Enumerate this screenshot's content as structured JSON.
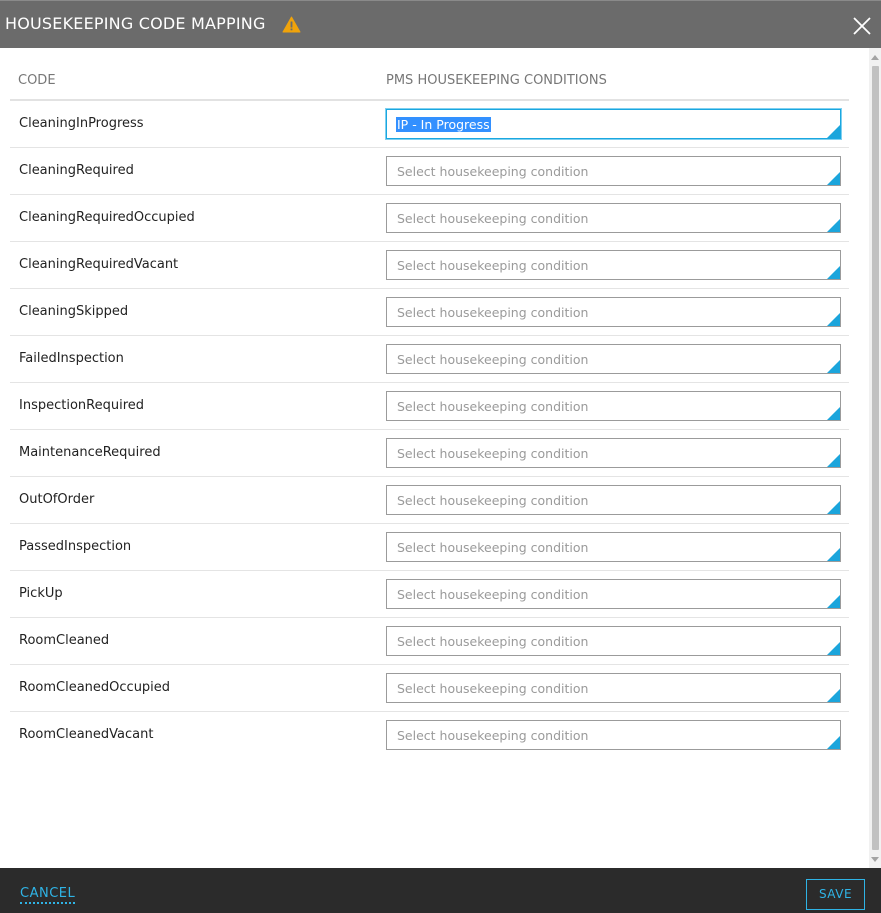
{
  "dialog": {
    "title": "HOUSEKEEPING CODE MAPPING",
    "warning_icon": "warning-triangle-icon",
    "close_icon": "close-icon"
  },
  "table": {
    "headers": {
      "code": "CODE",
      "pms": "PMS HOUSEKEEPING CONDITIONS"
    },
    "placeholder": "Select housekeeping condition",
    "rows": [
      {
        "code": "CleaningInProgress",
        "value": "IP - In Progress"
      },
      {
        "code": "CleaningRequired",
        "value": ""
      },
      {
        "code": "CleaningRequiredOccupied",
        "value": ""
      },
      {
        "code": "CleaningRequiredVacant",
        "value": ""
      },
      {
        "code": "CleaningSkipped",
        "value": ""
      },
      {
        "code": "FailedInspection",
        "value": ""
      },
      {
        "code": "InspectionRequired",
        "value": ""
      },
      {
        "code": "MaintenanceRequired",
        "value": ""
      },
      {
        "code": "OutOfOrder",
        "value": ""
      },
      {
        "code": "PassedInspection",
        "value": ""
      },
      {
        "code": "PickUp",
        "value": ""
      },
      {
        "code": "RoomCleaned",
        "value": ""
      },
      {
        "code": "RoomCleanedOccupied",
        "value": ""
      },
      {
        "code": "RoomCleanedVacant",
        "value": ""
      }
    ]
  },
  "footer": {
    "cancel_label": "CANCEL",
    "save_label": "SAVE"
  },
  "colors": {
    "titlebar": "#6b6b6b",
    "accent": "#1ba5dc",
    "footer": "#2b2b2b",
    "warning": "#f0a30a"
  }
}
